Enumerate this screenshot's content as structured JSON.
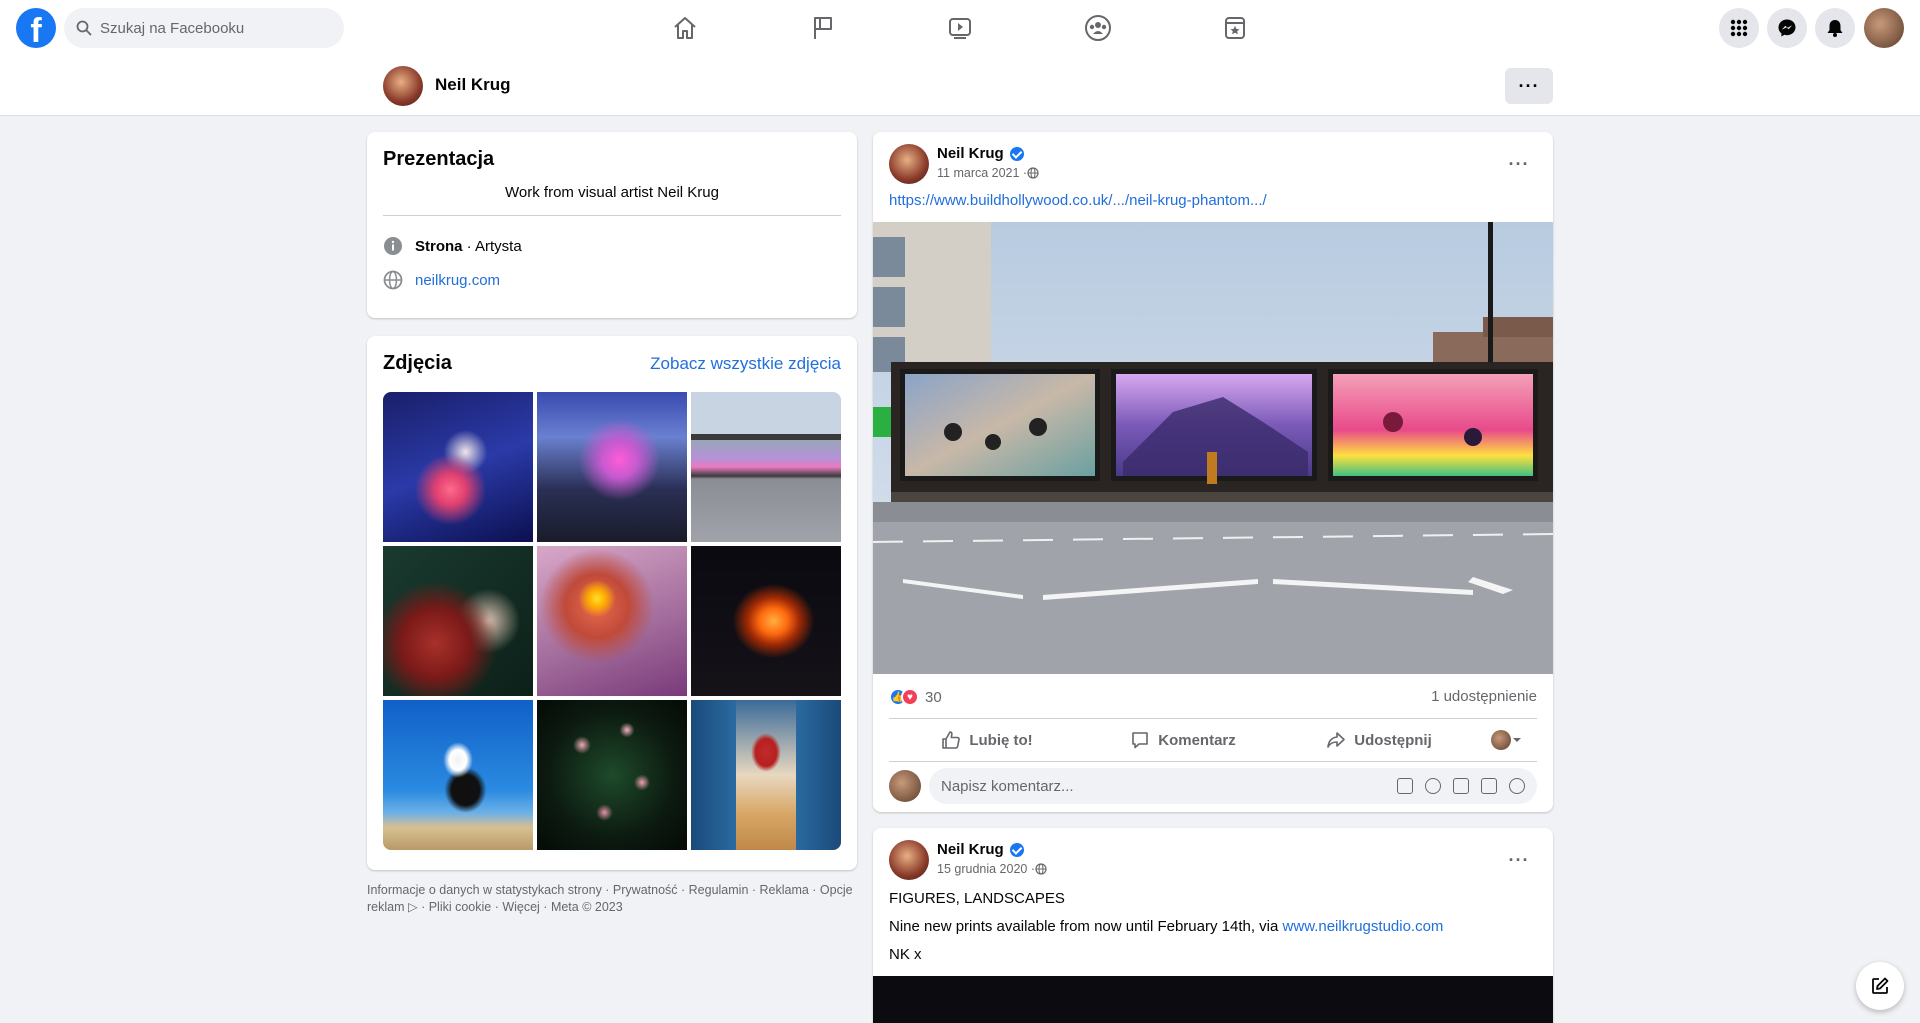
{
  "search": {
    "placeholder": "Szukaj na Facebooku"
  },
  "page": {
    "name": "Neil Krug",
    "more": "···"
  },
  "intro": {
    "title": "Prezentacja",
    "bio": "Work from visual artist Neil Krug",
    "category_strong": "Strona",
    "category_rest": " · Artysta",
    "website": "neilkrug.com"
  },
  "photos": {
    "title": "Zdjęcia",
    "see_all": "Zobacz wszystkie zdjęcia"
  },
  "footer": {
    "line1": "Informacje o danych w statystykach strony · Prywatność · Regulamin · Reklama · Opcje",
    "line2": "reklam ▷ · Pliki cookie · Więcej · Meta © 2023"
  },
  "post1": {
    "author": "Neil Krug",
    "date": "11 marca 2021 · ",
    "link": "https://www.buildhollywood.co.uk/.../neil-krug-phantom.../",
    "reaction_count": "30",
    "shares": "1 udostępnienie",
    "like": "Lubię to!",
    "comment": "Komentarz",
    "share": "Udostępnij",
    "comment_placeholder": "Napisz komentarz..."
  },
  "post2": {
    "author": "Neil Krug",
    "date": "15 grudnia 2020 · ",
    "line1": "FIGURES, LANDSCAPES",
    "line2_prefix": "Nine new prints available from now until February 14th, via ",
    "line2_link": "www.neilkrugstudio.com",
    "line3": "NK x"
  },
  "colors": {
    "brand": "#1877f2",
    "link": "#216fdb",
    "background": "#f0f2f5"
  },
  "icons": [
    "facebook-logo",
    "search-icon",
    "home-icon",
    "flag-icon",
    "video-icon",
    "groups-icon",
    "gaming-icon",
    "menu-grid-icon",
    "messenger-icon",
    "notifications-icon",
    "info-icon",
    "globe-icon",
    "like-icon",
    "comment-icon",
    "share-icon",
    "compose-icon"
  ]
}
